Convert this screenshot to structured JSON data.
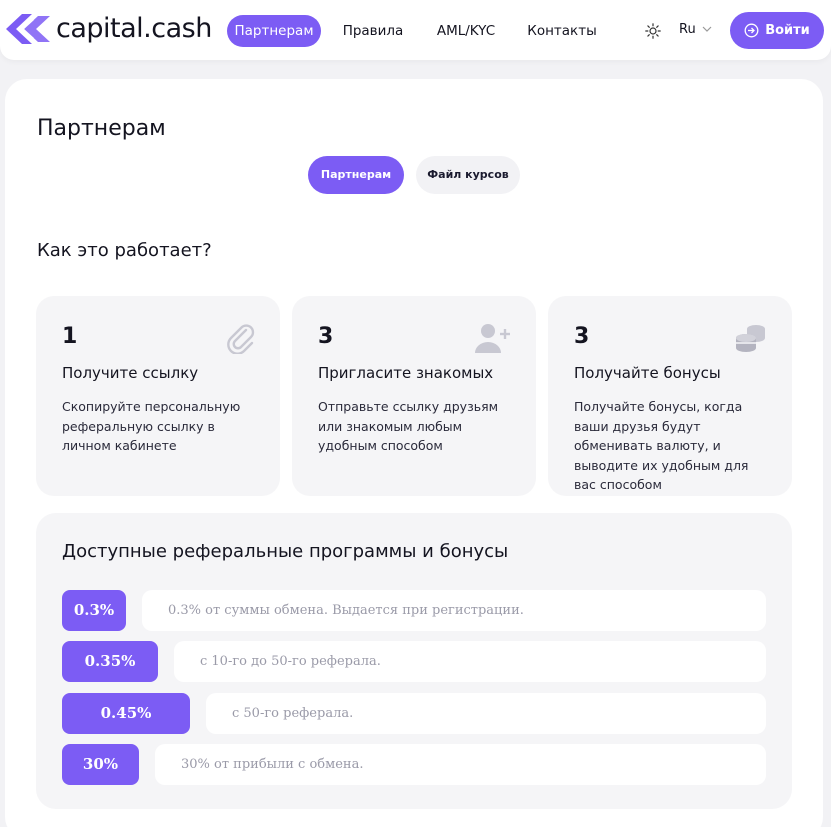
{
  "brand": {
    "name": "capital.cash",
    "accent": "#7c5cf4"
  },
  "nav": {
    "items": [
      {
        "label": "Партнерам",
        "active": true
      },
      {
        "label": "Правила",
        "active": false
      },
      {
        "label": "AML/KYC",
        "active": false
      },
      {
        "label": "Контакты",
        "active": false
      }
    ],
    "theme_icon": "sun-icon",
    "language": "Ru",
    "login_label": "Войти"
  },
  "page": {
    "title": "Партнерам",
    "tabs": [
      {
        "label": "Партнерам",
        "active": true
      },
      {
        "label": "Файл курсов",
        "active": false
      }
    ],
    "how_title": "Как это работает?",
    "steps": [
      {
        "num": "1",
        "title": "Получите ссылку",
        "desc": "Скопируйте персональную реферальную ссылку в личном кабинете",
        "icon": "paperclip-icon"
      },
      {
        "num": "3",
        "title": "Пригласите знакомых",
        "desc": "Отправьте ссылку друзьям или знакомым любым удобным способом",
        "icon": "add-user-icon"
      },
      {
        "num": "3",
        "title": "Получайте бонусы",
        "desc": "Получайте бонусы, когда ваши друзья будут обменивать валюту, и выводите их удобным для вас способом",
        "icon": "coins-icon"
      }
    ],
    "programs_title": "Доступные реферальные программы и бонусы",
    "programs": [
      {
        "rate": "0.3%",
        "text": "0.3% от суммы обмена. Выдается при регистрации."
      },
      {
        "rate": "0.35%",
        "text": "с 10-го до 50-го реферала."
      },
      {
        "rate": "0.45%",
        "text": "с 50-го реферала."
      },
      {
        "rate": "30%",
        "text": "30% от прибыли с обмена."
      }
    ]
  }
}
